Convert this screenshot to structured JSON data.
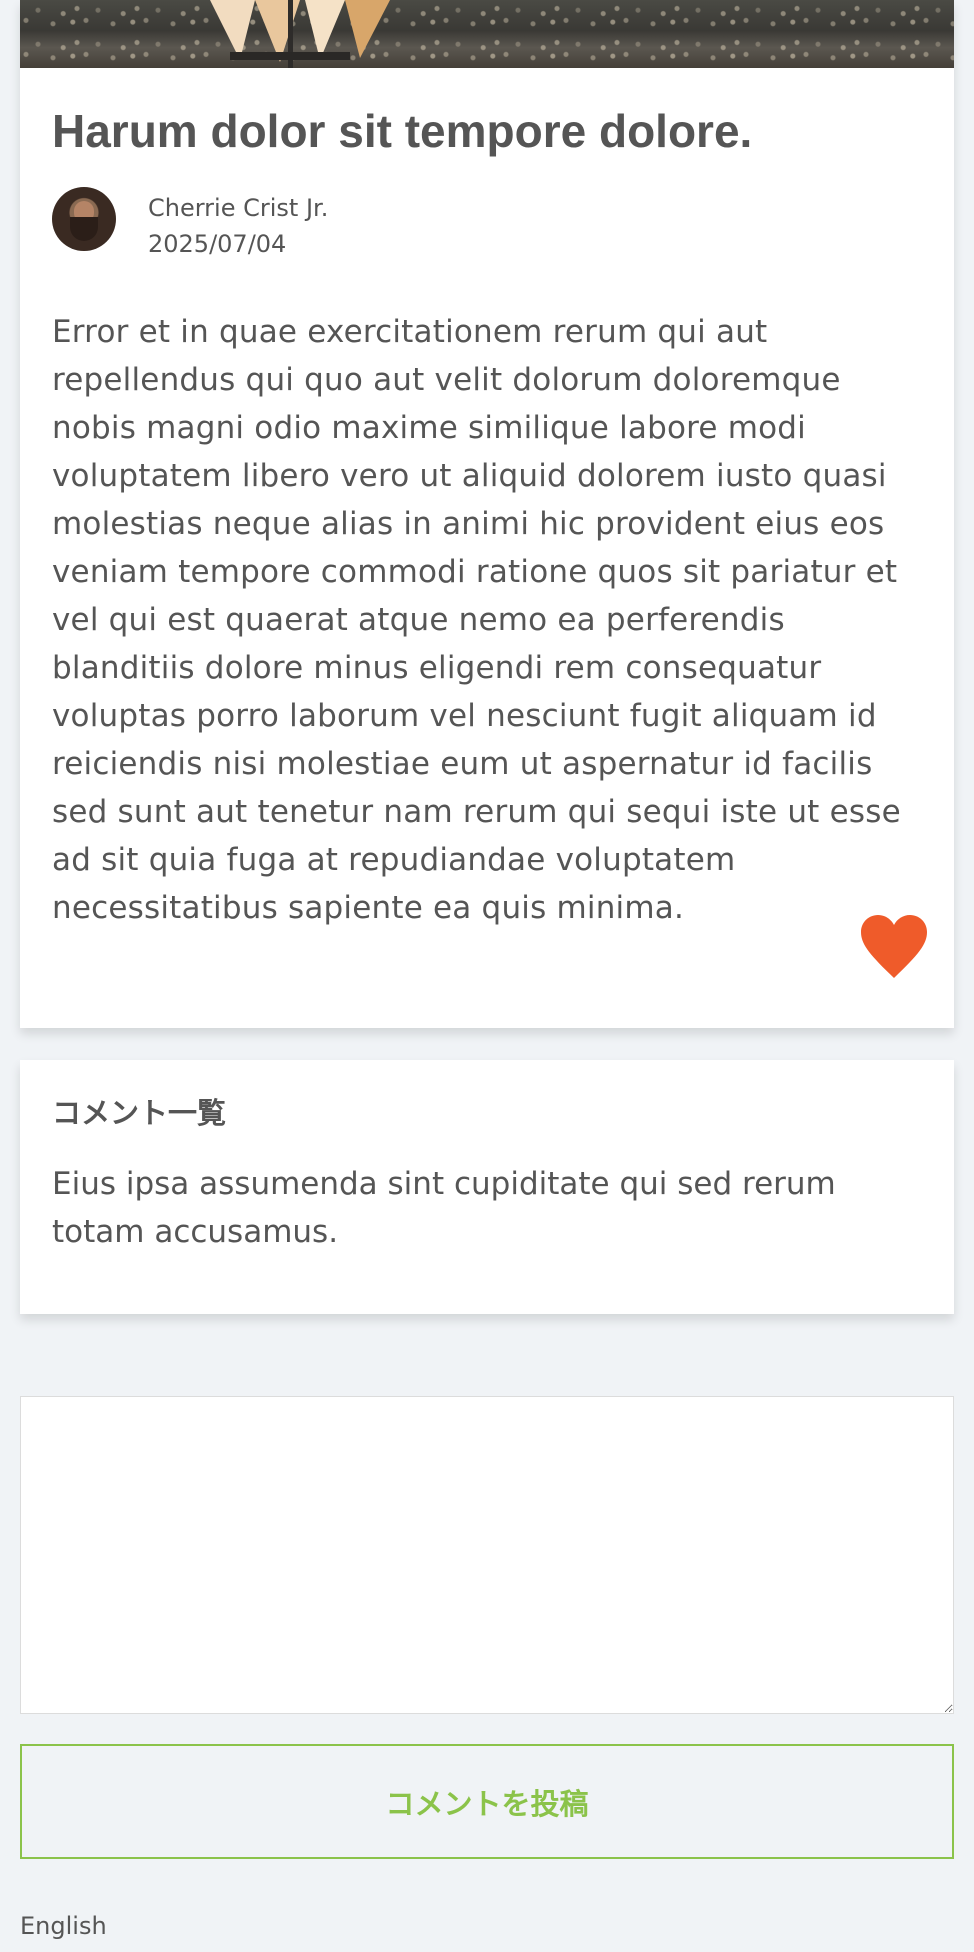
{
  "article": {
    "title": "Harum dolor sit tempore dolore.",
    "author_name": "Cherrie Crist Jr.",
    "date": "2025/07/04",
    "body": "Error et in quae exercitationem rerum qui aut repellendus qui quo aut velit dolorum doloremque nobis magni odio maxime similique labore modi voluptatem libero vero ut aliquid dolorem iusto quasi molestias neque alias in animi hic provident eius eos veniam tempore commodi ratione quos sit pariatur et vel qui est quaerat atque nemo ea perferendis blanditiis dolore minus eligendi rem consequatur voluptas porro laborum vel nesciunt fugit aliquam id reiciendis nisi molestiae eum ut aspernatur id facilis sed sunt aut tenetur nam rerum qui sequi iste ut esse ad sit quia fuga at repudiandae voluptatem necessitatibus sapiente ea quis minima."
  },
  "like_icon": {
    "icon": "heart-icon",
    "color": "#ef5b2a"
  },
  "comments": {
    "heading": "コメント一覧",
    "items": [
      {
        "text": "Eius ipsa assumenda sint cupiditate qui sed rerum totam accusamus."
      }
    ]
  },
  "form": {
    "comment_value": "",
    "submit_label": "コメントを投稿"
  },
  "footer": {
    "language_label": "English"
  },
  "colors": {
    "page_background": "#f0f3f6",
    "text": "#555555",
    "accent_green": "#8bc34a",
    "heart": "#ef5b2a"
  }
}
